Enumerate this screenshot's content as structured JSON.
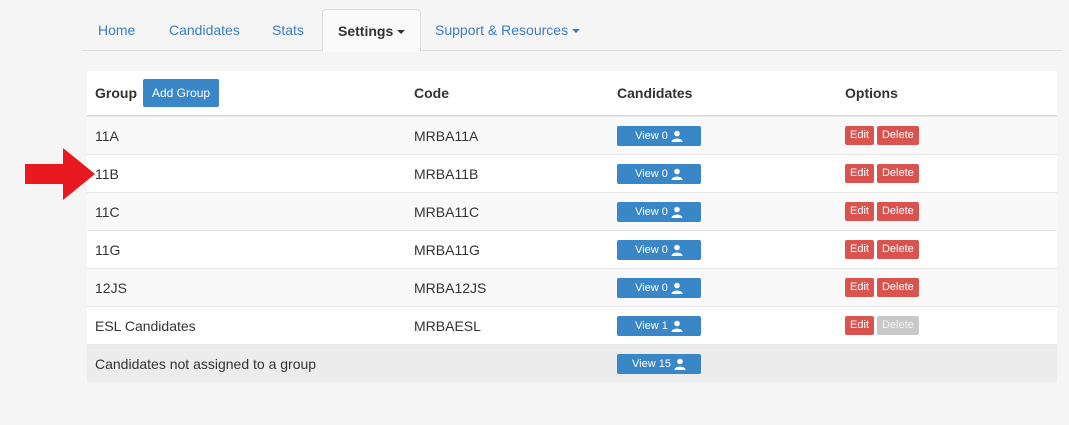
{
  "nav": {
    "tabs": [
      {
        "label": "Home"
      },
      {
        "label": "Candidates"
      },
      {
        "label": "Stats"
      },
      {
        "label": "Settings"
      },
      {
        "label": "Support & Resources"
      }
    ]
  },
  "table": {
    "headers": {
      "group": "Group",
      "code": "Code",
      "candidates": "Candidates",
      "options": "Options"
    },
    "add_group_label": "Add Group",
    "edit_label": "Edit",
    "delete_label": "Delete",
    "rows": [
      {
        "group": "11A",
        "code": "MRBA11A",
        "view": "View 0"
      },
      {
        "group": "11B",
        "code": "MRBA11B",
        "view": "View 0"
      },
      {
        "group": "11C",
        "code": "MRBA11C",
        "view": "View 0"
      },
      {
        "group": "11G",
        "code": "MRBA11G",
        "view": "View 0"
      },
      {
        "group": "12JS",
        "code": "MRBA12JS",
        "view": "View 0"
      },
      {
        "group": "ESL Candidates",
        "code": "MRBAESL",
        "view": "View 1"
      }
    ],
    "footer": {
      "label": "Candidates not assigned to a group",
      "view": "View 15"
    }
  },
  "colors": {
    "link": "#3a7ec0",
    "primary": "#3a87c8",
    "danger": "#d9534f",
    "arrow": "#e8191f"
  }
}
